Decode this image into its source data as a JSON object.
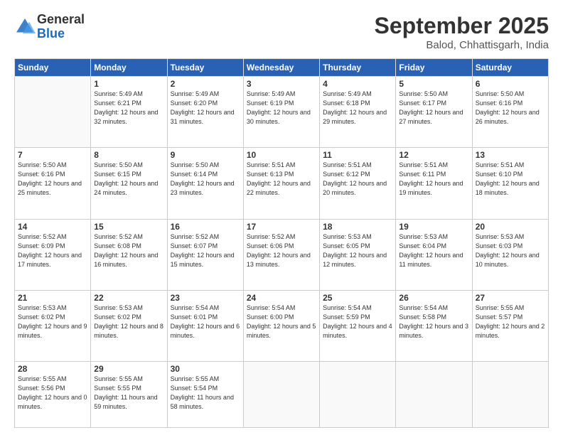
{
  "logo": {
    "general": "General",
    "blue": "Blue"
  },
  "header": {
    "month": "September 2025",
    "location": "Balod, Chhattisgarh, India"
  },
  "weekdays": [
    "Sunday",
    "Monday",
    "Tuesday",
    "Wednesday",
    "Thursday",
    "Friday",
    "Saturday"
  ],
  "weeks": [
    [
      {
        "day": "",
        "sunrise": "",
        "sunset": "",
        "daylight": ""
      },
      {
        "day": "1",
        "sunrise": "Sunrise: 5:49 AM",
        "sunset": "Sunset: 6:21 PM",
        "daylight": "Daylight: 12 hours and 32 minutes."
      },
      {
        "day": "2",
        "sunrise": "Sunrise: 5:49 AM",
        "sunset": "Sunset: 6:20 PM",
        "daylight": "Daylight: 12 hours and 31 minutes."
      },
      {
        "day": "3",
        "sunrise": "Sunrise: 5:49 AM",
        "sunset": "Sunset: 6:19 PM",
        "daylight": "Daylight: 12 hours and 30 minutes."
      },
      {
        "day": "4",
        "sunrise": "Sunrise: 5:49 AM",
        "sunset": "Sunset: 6:18 PM",
        "daylight": "Daylight: 12 hours and 29 minutes."
      },
      {
        "day": "5",
        "sunrise": "Sunrise: 5:50 AM",
        "sunset": "Sunset: 6:17 PM",
        "daylight": "Daylight: 12 hours and 27 minutes."
      },
      {
        "day": "6",
        "sunrise": "Sunrise: 5:50 AM",
        "sunset": "Sunset: 6:16 PM",
        "daylight": "Daylight: 12 hours and 26 minutes."
      }
    ],
    [
      {
        "day": "7",
        "sunrise": "Sunrise: 5:50 AM",
        "sunset": "Sunset: 6:16 PM",
        "daylight": "Daylight: 12 hours and 25 minutes."
      },
      {
        "day": "8",
        "sunrise": "Sunrise: 5:50 AM",
        "sunset": "Sunset: 6:15 PM",
        "daylight": "Daylight: 12 hours and 24 minutes."
      },
      {
        "day": "9",
        "sunrise": "Sunrise: 5:50 AM",
        "sunset": "Sunset: 6:14 PM",
        "daylight": "Daylight: 12 hours and 23 minutes."
      },
      {
        "day": "10",
        "sunrise": "Sunrise: 5:51 AM",
        "sunset": "Sunset: 6:13 PM",
        "daylight": "Daylight: 12 hours and 22 minutes."
      },
      {
        "day": "11",
        "sunrise": "Sunrise: 5:51 AM",
        "sunset": "Sunset: 6:12 PM",
        "daylight": "Daylight: 12 hours and 20 minutes."
      },
      {
        "day": "12",
        "sunrise": "Sunrise: 5:51 AM",
        "sunset": "Sunset: 6:11 PM",
        "daylight": "Daylight: 12 hours and 19 minutes."
      },
      {
        "day": "13",
        "sunrise": "Sunrise: 5:51 AM",
        "sunset": "Sunset: 6:10 PM",
        "daylight": "Daylight: 12 hours and 18 minutes."
      }
    ],
    [
      {
        "day": "14",
        "sunrise": "Sunrise: 5:52 AM",
        "sunset": "Sunset: 6:09 PM",
        "daylight": "Daylight: 12 hours and 17 minutes."
      },
      {
        "day": "15",
        "sunrise": "Sunrise: 5:52 AM",
        "sunset": "Sunset: 6:08 PM",
        "daylight": "Daylight: 12 hours and 16 minutes."
      },
      {
        "day": "16",
        "sunrise": "Sunrise: 5:52 AM",
        "sunset": "Sunset: 6:07 PM",
        "daylight": "Daylight: 12 hours and 15 minutes."
      },
      {
        "day": "17",
        "sunrise": "Sunrise: 5:52 AM",
        "sunset": "Sunset: 6:06 PM",
        "daylight": "Daylight: 12 hours and 13 minutes."
      },
      {
        "day": "18",
        "sunrise": "Sunrise: 5:53 AM",
        "sunset": "Sunset: 6:05 PM",
        "daylight": "Daylight: 12 hours and 12 minutes."
      },
      {
        "day": "19",
        "sunrise": "Sunrise: 5:53 AM",
        "sunset": "Sunset: 6:04 PM",
        "daylight": "Daylight: 12 hours and 11 minutes."
      },
      {
        "day": "20",
        "sunrise": "Sunrise: 5:53 AM",
        "sunset": "Sunset: 6:03 PM",
        "daylight": "Daylight: 12 hours and 10 minutes."
      }
    ],
    [
      {
        "day": "21",
        "sunrise": "Sunrise: 5:53 AM",
        "sunset": "Sunset: 6:02 PM",
        "daylight": "Daylight: 12 hours and 9 minutes."
      },
      {
        "day": "22",
        "sunrise": "Sunrise: 5:53 AM",
        "sunset": "Sunset: 6:02 PM",
        "daylight": "Daylight: 12 hours and 8 minutes."
      },
      {
        "day": "23",
        "sunrise": "Sunrise: 5:54 AM",
        "sunset": "Sunset: 6:01 PM",
        "daylight": "Daylight: 12 hours and 6 minutes."
      },
      {
        "day": "24",
        "sunrise": "Sunrise: 5:54 AM",
        "sunset": "Sunset: 6:00 PM",
        "daylight": "Daylight: 12 hours and 5 minutes."
      },
      {
        "day": "25",
        "sunrise": "Sunrise: 5:54 AM",
        "sunset": "Sunset: 5:59 PM",
        "daylight": "Daylight: 12 hours and 4 minutes."
      },
      {
        "day": "26",
        "sunrise": "Sunrise: 5:54 AM",
        "sunset": "Sunset: 5:58 PM",
        "daylight": "Daylight: 12 hours and 3 minutes."
      },
      {
        "day": "27",
        "sunrise": "Sunrise: 5:55 AM",
        "sunset": "Sunset: 5:57 PM",
        "daylight": "Daylight: 12 hours and 2 minutes."
      }
    ],
    [
      {
        "day": "28",
        "sunrise": "Sunrise: 5:55 AM",
        "sunset": "Sunset: 5:56 PM",
        "daylight": "Daylight: 12 hours and 0 minutes."
      },
      {
        "day": "29",
        "sunrise": "Sunrise: 5:55 AM",
        "sunset": "Sunset: 5:55 PM",
        "daylight": "Daylight: 11 hours and 59 minutes."
      },
      {
        "day": "30",
        "sunrise": "Sunrise: 5:55 AM",
        "sunset": "Sunset: 5:54 PM",
        "daylight": "Daylight: 11 hours and 58 minutes."
      },
      {
        "day": "",
        "sunrise": "",
        "sunset": "",
        "daylight": ""
      },
      {
        "day": "",
        "sunrise": "",
        "sunset": "",
        "daylight": ""
      },
      {
        "day": "",
        "sunrise": "",
        "sunset": "",
        "daylight": ""
      },
      {
        "day": "",
        "sunrise": "",
        "sunset": "",
        "daylight": ""
      }
    ]
  ]
}
